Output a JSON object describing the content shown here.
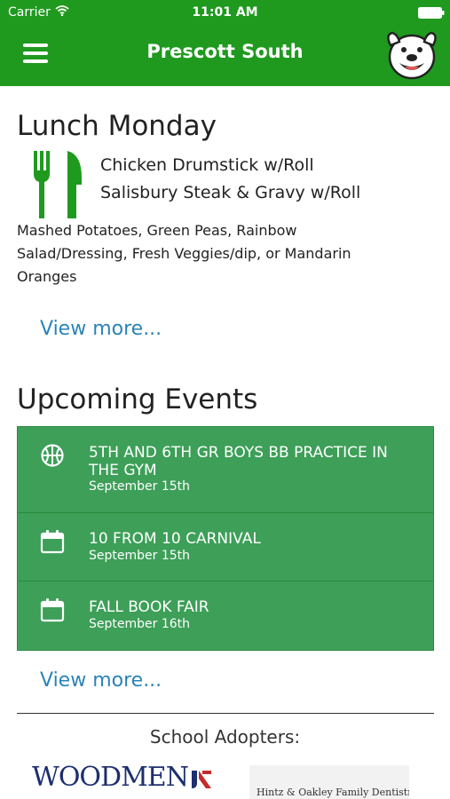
{
  "status_bar": {
    "carrier": "Carrier",
    "time": "11:01 AM"
  },
  "header": {
    "title": "Prescott South"
  },
  "lunch": {
    "title": "Lunch Monday",
    "entrees": [
      "Chicken Drumstick w/Roll",
      "Salisbury Steak & Gravy w/Roll"
    ],
    "sides": "Mashed Potatoes, Green Peas, Rainbow Salad/Dressing, Fresh Veggies/dip, or Mandarin Oranges",
    "view_more": "View more..."
  },
  "events": {
    "title": "Upcoming Events",
    "items": [
      {
        "title": "5TH AND 6TH GR BOYS BB PRACTICE IN THE GYM",
        "date": "September 15th",
        "icon": "basketball-icon"
      },
      {
        "title": "10 FROM 10 CARNIVAL",
        "date": "September 15th",
        "icon": "calendar-icon"
      },
      {
        "title": "FALL BOOK FAIR",
        "date": "September 16th",
        "icon": "calendar-icon"
      }
    ],
    "view_more": "View more..."
  },
  "adopters": {
    "label": "School Adopters:",
    "logos": [
      {
        "text": "WOODMEN"
      },
      {
        "text": "Hintz & Oakley Family Dentistry"
      }
    ]
  },
  "colors": {
    "header_green": "#1f9a1f",
    "event_green": "#3d9f58",
    "link_blue": "#2a84b8"
  }
}
